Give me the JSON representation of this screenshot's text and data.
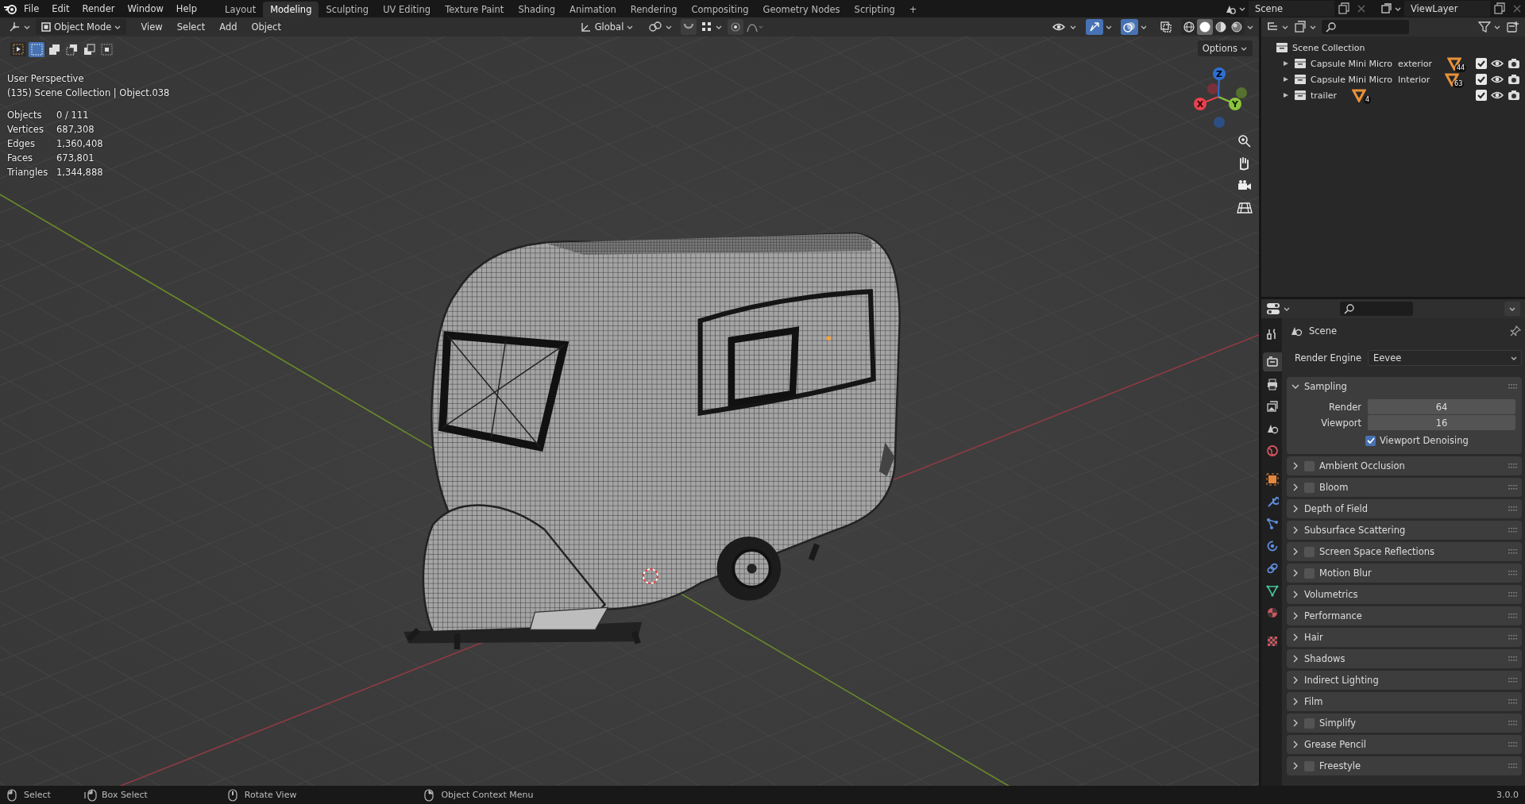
{
  "topbar": {
    "menus": [
      "File",
      "Edit",
      "Render",
      "Window",
      "Help"
    ],
    "workspaces": [
      {
        "label": "Layout",
        "selected": false
      },
      {
        "label": "Modeling",
        "selected": true
      },
      {
        "label": "Sculpting",
        "selected": false
      },
      {
        "label": "UV Editing",
        "selected": false
      },
      {
        "label": "Texture Paint",
        "selected": false
      },
      {
        "label": "Shading",
        "selected": false
      },
      {
        "label": "Animation",
        "selected": false
      },
      {
        "label": "Rendering",
        "selected": false
      },
      {
        "label": "Compositing",
        "selected": false
      },
      {
        "label": "Geometry Nodes",
        "selected": false
      },
      {
        "label": "Scripting",
        "selected": false
      }
    ],
    "add_tab": "+",
    "scene": "Scene",
    "view_layer": "ViewLayer"
  },
  "viewport": {
    "mode": "Object Mode",
    "menus": [
      "View",
      "Select",
      "Add",
      "Object"
    ],
    "orientation": "Global",
    "gizmos_on": true,
    "overlays_on": true,
    "xray_on": false,
    "shading": [
      {
        "kind": "wireframe",
        "selected": false
      },
      {
        "kind": "solid",
        "selected": true
      },
      {
        "kind": "material",
        "selected": false
      },
      {
        "kind": "rendered",
        "selected": false
      }
    ],
    "select_modes": [
      {
        "kind": "set",
        "selected": true
      },
      {
        "kind": "extend",
        "selected": false
      },
      {
        "kind": "subtract",
        "selected": false
      },
      {
        "kind": "invert",
        "selected": false
      },
      {
        "kind": "intersect",
        "selected": false
      }
    ],
    "options": "Options",
    "view_name": "User Perspective",
    "context": "(135) Scene Collection | Object.038",
    "stats": [
      {
        "label": "Objects",
        "value": "0 / 111"
      },
      {
        "label": "Vertices",
        "value": "687,308"
      },
      {
        "label": "Edges",
        "value": "1,360,408"
      },
      {
        "label": "Faces",
        "value": "673,801"
      },
      {
        "label": "Triangles",
        "value": "1,344,888"
      }
    ],
    "gizmo": {
      "x": "X",
      "y": "Y",
      "z": "Z"
    }
  },
  "outliner": {
    "root": "Scene Collection",
    "items": [
      {
        "name": "Capsule Mini Micro  exterior",
        "count": "44",
        "included": true
      },
      {
        "name": "Capsule Mini Micro  Interior",
        "count": "63",
        "included": true
      },
      {
        "name": "trailer",
        "count": "4",
        "included": true
      }
    ]
  },
  "properties": {
    "tabs": [
      {
        "kind": "tool",
        "selected": false
      },
      {
        "kind": "render",
        "selected": true
      },
      {
        "kind": "output",
        "selected": false
      },
      {
        "kind": "view_layer",
        "selected": false
      },
      {
        "kind": "scene",
        "selected": false
      },
      {
        "kind": "world",
        "selected": false
      },
      {
        "kind": "object",
        "selected": false
      },
      {
        "kind": "modifier",
        "selected": false
      },
      {
        "kind": "particles",
        "selected": false
      },
      {
        "kind": "physics",
        "selected": false
      },
      {
        "kind": "constraints",
        "selected": false
      },
      {
        "kind": "data",
        "selected": false
      },
      {
        "kind": "material",
        "selected": false
      },
      {
        "kind": "texture",
        "selected": false
      }
    ],
    "context": "Scene",
    "render_engine_label": "Render Engine",
    "render_engine": "Eevee",
    "panels": [
      {
        "title": "Sampling",
        "kind": "plain",
        "expanded": true,
        "fields": [
          {
            "label": "Render",
            "value": "64"
          },
          {
            "label": "Viewport",
            "value": "16"
          }
        ],
        "options": [
          {
            "label": "Viewport Denoising",
            "checked": true
          }
        ]
      },
      {
        "title": "Ambient Occlusion",
        "kind": "toggle",
        "enabled": false,
        "expanded": false
      },
      {
        "title": "Bloom",
        "kind": "toggle",
        "enabled": false,
        "expanded": false
      },
      {
        "title": "Depth of Field",
        "kind": "plain",
        "expanded": false
      },
      {
        "title": "Subsurface Scattering",
        "kind": "plain",
        "expanded": false
      },
      {
        "title": "Screen Space Reflections",
        "kind": "toggle",
        "enabled": false,
        "expanded": false
      },
      {
        "title": "Motion Blur",
        "kind": "toggle",
        "enabled": false,
        "expanded": false
      },
      {
        "title": "Volumetrics",
        "kind": "plain",
        "expanded": false
      },
      {
        "title": "Performance",
        "kind": "plain",
        "expanded": false
      },
      {
        "title": "Hair",
        "kind": "plain",
        "expanded": false
      },
      {
        "title": "Shadows",
        "kind": "plain",
        "expanded": false
      },
      {
        "title": "Indirect Lighting",
        "kind": "plain",
        "expanded": false
      },
      {
        "title": "Film",
        "kind": "plain",
        "expanded": false
      },
      {
        "title": "Simplify",
        "kind": "toggle",
        "enabled": false,
        "expanded": false
      },
      {
        "title": "Grease Pencil",
        "kind": "plain",
        "expanded": false
      },
      {
        "title": "Freestyle",
        "kind": "toggle",
        "enabled": false,
        "expanded": false
      }
    ]
  },
  "statusbar": {
    "hints": [
      {
        "kind": "left",
        "label": "Select"
      },
      {
        "kind": "left_drag",
        "label": "Box Select"
      },
      {
        "kind": "middle",
        "label": "Rotate View"
      },
      {
        "kind": "right",
        "label": "Object Context Menu"
      }
    ],
    "version": "3.0.0"
  }
}
